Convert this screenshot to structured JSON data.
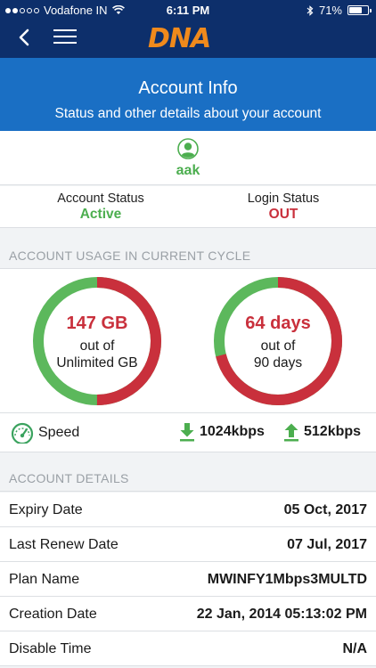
{
  "status_bar": {
    "carrier": "Vodafone IN",
    "time": "6:11 PM",
    "battery": "71%",
    "battery_level": 0.71
  },
  "nav": {
    "logo_text": "DNA",
    "back_icon": "chevron-left-icon",
    "menu_icon": "hamburger-menu-icon"
  },
  "header": {
    "title": "Account Info",
    "subtitle": "Status and other details about your account"
  },
  "user": {
    "name": "aak",
    "avatar_icon": "user-avatar-icon"
  },
  "account_status": {
    "label": "Account Status",
    "value": "Active",
    "color": "#4cae4f"
  },
  "login_status": {
    "label": "Login Status",
    "value": "OUT",
    "color": "#c9303c"
  },
  "usage_section": {
    "title": "ACCOUNT USAGE IN CURRENT CYCLE",
    "data": {
      "used": "147 GB",
      "out_of": "out of",
      "limit": "Unlimited GB",
      "used_fraction": 0.5
    },
    "days": {
      "used": "64 days",
      "out_of": "out of",
      "limit": "90 days",
      "used_fraction": 0.711
    },
    "colors": {
      "used": "#c9303c",
      "remaining": "#5cb85c"
    }
  },
  "speed": {
    "label": "Speed",
    "download": "1024kbps",
    "upload": "512kbps",
    "icons": [
      "speedometer-icon",
      "download-arrow-icon",
      "upload-arrow-icon"
    ]
  },
  "details_section": {
    "title": "ACCOUNT DETAILS",
    "rows": [
      {
        "label": "Expiry Date",
        "value": "05 Oct, 2017"
      },
      {
        "label": "Last Renew Date",
        "value": "07 Jul, 2017"
      },
      {
        "label": "Plan Name",
        "value": "MWINFY1Mbps3MULTD"
      },
      {
        "label": "Creation Date",
        "value": "22 Jan, 2014 05:13:02 PM"
      },
      {
        "label": "Disable Time",
        "value": "N/A"
      }
    ]
  }
}
